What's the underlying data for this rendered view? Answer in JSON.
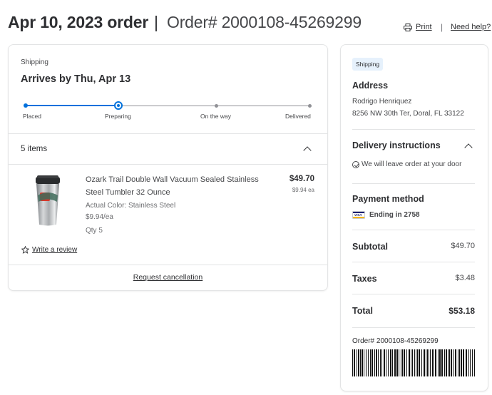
{
  "header": {
    "order_date": "Apr 10, 2023 order",
    "separator": "|",
    "order_number": "Order# 2000108-45269299",
    "print_label": "Print",
    "help_label": "Need help?"
  },
  "shipment": {
    "label": "Shipping",
    "arrival": "Arrives by Thu, Apr 13",
    "progress": {
      "steps": [
        "Placed",
        "Preparing",
        "On the way",
        "Delivered"
      ],
      "current_step": "Preparing"
    },
    "items_count": "5 items",
    "item": {
      "name": "Ozark Trail Double Wall Vacuum Sealed Stainless Steel Tumbler 32 Ounce",
      "color": "Actual Color: Stainless Steel",
      "unit_price": "$9.94/ea",
      "qty": "Qty 5",
      "total_price": "$49.70",
      "each_price": "$9.94 ea"
    },
    "write_review": "Write a review",
    "request_cancel": "Request cancellation"
  },
  "sidebar": {
    "badge": "Shipping",
    "address_title": "Address",
    "address_name": "Rodrigo Henriquez",
    "address_line": "8256 NW 30th Ter, Doral, FL 33122",
    "delivery_title": "Delivery instructions",
    "delivery_note": "We will leave order at your door",
    "payment_title": "Payment method",
    "card_brand": "VISA",
    "payment_ending": "Ending in 2758",
    "subtotal_label": "Subtotal",
    "subtotal_value": "$49.70",
    "taxes_label": "Taxes",
    "taxes_value": "$3.48",
    "total_label": "Total",
    "total_value": "$53.18",
    "order_number": "Order# 2000108-45269299"
  },
  "colors": {
    "accent": "#0071dc",
    "text": "#2e2f32",
    "badge_bg": "#e6f1fc"
  }
}
